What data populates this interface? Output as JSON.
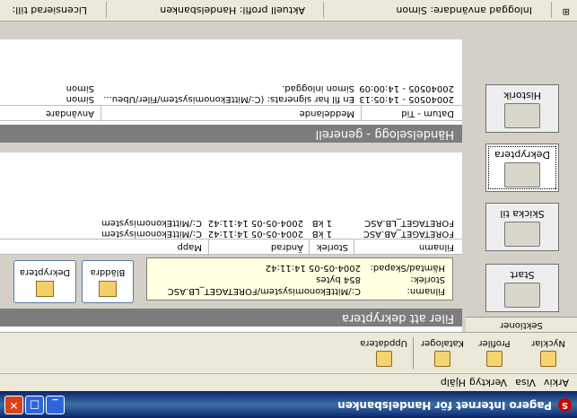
{
  "window": {
    "title": "Pagero Internet för Handelsbanken",
    "app_icon": "S",
    "buttons": {
      "minimize": "_",
      "maximize": "□",
      "close": "✕"
    }
  },
  "menubar": {
    "items": [
      "Arkiv",
      "Visa",
      "Verktyg",
      "Hjälp"
    ]
  },
  "toolbar": {
    "items": [
      {
        "label": "Nycklar",
        "icon": "key-icon"
      },
      {
        "label": "Profiler",
        "icon": "profile-icon"
      },
      {
        "label": "Kataloger",
        "icon": "folder-icon"
      },
      {
        "label": "Uppdatera",
        "icon": "refresh-icon"
      }
    ]
  },
  "sidebar": {
    "header": "Sektioner",
    "items": [
      {
        "label": "Start",
        "icon": "house-icon"
      },
      {
        "label": "Skicka til",
        "icon": "send-icon"
      },
      {
        "label": "Dekryptera",
        "icon": "lock-icon"
      },
      {
        "label": "Historik",
        "icon": "book-icon"
      }
    ]
  },
  "decrypt": {
    "title": "Filer att dekryptera",
    "info": {
      "filename_label": "Filnamn:",
      "filename_value": "C:/MittEkonomisystem/FORETAGET_LB.ASC",
      "size_label": "Storlek:",
      "size_value": "854 bytes",
      "date_label": "Hämtad/Skapad:",
      "date_value": "2004-05-05 14:11:42"
    },
    "browse_button": "Bläddra",
    "decrypt_button": "Dekryptera",
    "columns": [
      "Filnamn",
      "Storlek",
      "Ändrad",
      "Mapp"
    ],
    "rows": [
      [
        "FORETAGET_AB.ASC",
        "1 kB",
        "2004-05-05 14:11:42",
        "C:/MittEkonomisystem"
      ],
      [
        "FORETAGET_LB.ASC",
        "1 kB",
        "2004-05-05 14:11:42",
        "C:/MittEkonomisystem"
      ]
    ]
  },
  "log": {
    "title": "Händelselogg - generell",
    "columns": [
      "Datum - Tid",
      "Meddelande",
      "Användare"
    ],
    "rows": [
      [
        "20040505 - 14:05:13",
        "En fil har signerats: (C:/MittEkonomisystem/Filer/Ubeu...",
        "Simon"
      ],
      [
        "20040505 - 14:00:09",
        "Simon inloggad.",
        "Simon"
      ]
    ]
  },
  "statusbar": {
    "user": "Inloggad användare: Simon",
    "profile": "Aktuell profil: Handelsbanken",
    "license": "Licensierad till:"
  }
}
